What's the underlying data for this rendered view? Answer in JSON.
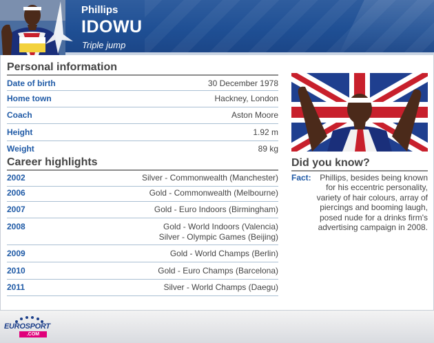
{
  "header": {
    "first_name": "Phillips",
    "last_name": "IDOWU",
    "event": "Triple jump"
  },
  "personal": {
    "title": "Personal information",
    "rows": [
      {
        "label": "Date of birth",
        "value": "30 December 1978"
      },
      {
        "label": "Home town",
        "value": "Hackney, London"
      },
      {
        "label": "Coach",
        "value": "Aston Moore"
      },
      {
        "label": "Height",
        "value": "1.92 m"
      },
      {
        "label": "Weight",
        "value": "89 kg"
      }
    ]
  },
  "career": {
    "title": "Career highlights",
    "rows": [
      {
        "year": "2002",
        "lines": [
          "Silver - Commonwealth (Manchester)"
        ]
      },
      {
        "year": "2006",
        "lines": [
          "Gold - Commonwealth (Melbourne)"
        ]
      },
      {
        "year": "2007",
        "lines": [
          "Gold - Euro Indoors (Birmingham)"
        ]
      },
      {
        "year": "2008",
        "lines": [
          "Gold - World Indoors (Valencia)",
          "Silver - Olympic Games (Beijing)"
        ]
      },
      {
        "year": "2009",
        "lines": [
          "Gold - World Champs (Berlin)"
        ]
      },
      {
        "year": "2010",
        "lines": [
          "Gold - Euro Champs (Barcelona)"
        ]
      },
      {
        "year": "2011",
        "lines": [
          "Silver - World Champs (Daegu)"
        ]
      }
    ]
  },
  "did_you_know": {
    "title": "Did you know?",
    "fact_label": "Fact:",
    "fact_text": "Phillips, besides being known for his eccentric personality, variety of hair colours, array of piercings and booming laugh, posed nude for a drinks firm's advertising campaign in 2008."
  },
  "footer": {
    "logo_text": "EUROSPORT",
    "logo_sub": ".COM"
  },
  "colors": {
    "header_blue": "#1f4f94",
    "label_blue": "#1f5aa6",
    "divider": "#a9bfd3",
    "logo_pink": "#e0007a"
  }
}
